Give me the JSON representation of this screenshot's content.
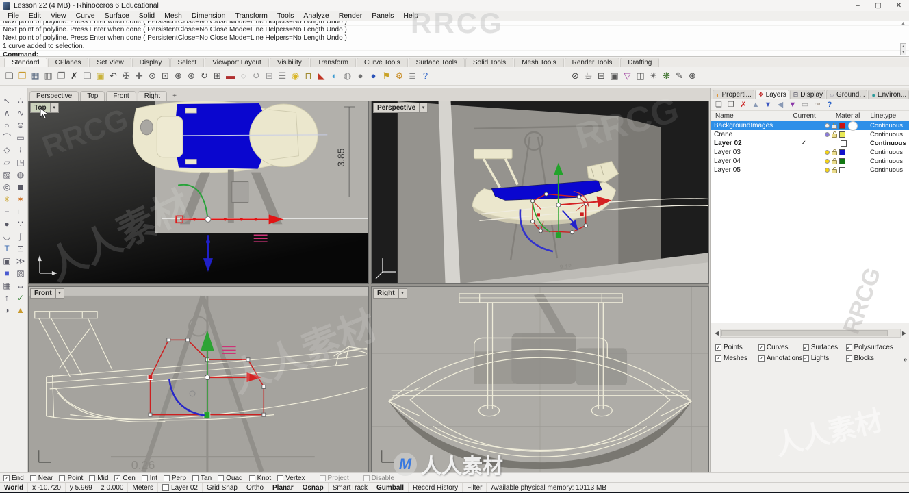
{
  "window": {
    "title": "Lesson 22 (4 MB) - Rhinoceros 6 Educational"
  },
  "menu": [
    "File",
    "Edit",
    "View",
    "Curve",
    "Surface",
    "Solid",
    "Mesh",
    "Dimension",
    "Transform",
    "Tools",
    "Analyze",
    "Render",
    "Panels",
    "Help"
  ],
  "command": {
    "history": [
      "Next point of polyline. Press Enter when done ( PersistentClose=No  Close  Mode=Line  Helpers=No  Length  Undo )",
      "Next point of polyline. Press Enter when done ( PersistentClose=No  Close  Mode=Line  Helpers=No  Length  Undo )",
      "Next point of polyline. Press Enter when done ( PersistentClose=No  Close  Mode=Line  Helpers=No  Length  Undo )",
      "1 curve added to selection."
    ],
    "prompt": "Command:"
  },
  "toolbar_tabs": [
    "Standard",
    "CPlanes",
    "Set View",
    "Display",
    "Select",
    "Viewport Layout",
    "Visibility",
    "Transform",
    "Curve Tools",
    "Surface Tools",
    "Solid Tools",
    "Mesh Tools",
    "Render Tools",
    "Drafting"
  ],
  "icons": {
    "window_controls": [
      {
        "n": "minimize",
        "g": "–"
      },
      {
        "n": "maximize",
        "g": "▢"
      },
      {
        "n": "close",
        "g": "✕"
      }
    ],
    "dropdown": "▾",
    "check": "✓",
    "scroll_up": "▲",
    "scroll_down": "▼",
    "standard": [
      {
        "n": "new-file",
        "g": "❏",
        "c": "#555555"
      },
      {
        "n": "open-file",
        "g": "❒",
        "c": "#c99a2e"
      },
      {
        "n": "save",
        "g": "▦",
        "c": "#5f6f85"
      },
      {
        "n": "print",
        "g": "▥",
        "c": "#6a6a6a"
      },
      {
        "n": "copy-to-clipboard",
        "g": "❐",
        "c": "#6a6a6a"
      },
      {
        "n": "delete",
        "g": "✗",
        "c": "#3a3a3a"
      },
      {
        "n": "copy",
        "g": "❑",
        "c": "#6a6a6a"
      },
      {
        "n": "paste",
        "g": "▣",
        "c": "#c9b23a"
      },
      {
        "n": "undo",
        "g": "↶",
        "c": "#4a4a4a"
      },
      {
        "n": "pan",
        "g": "✠",
        "c": "#6a6a6a"
      },
      {
        "n": "move",
        "g": "✚",
        "c": "#6a6a6a"
      },
      {
        "n": "zoom",
        "g": "⊙",
        "c": "#5a5a5a"
      },
      {
        "n": "zoom-window",
        "g": "⊡",
        "c": "#5a5a5a"
      },
      {
        "n": "zoom-dynamic",
        "g": "⊕",
        "c": "#5a5a5a"
      },
      {
        "n": "zoom-extents",
        "g": "⊛",
        "c": "#5a5a5a"
      },
      {
        "n": "rotate-view",
        "g": "↻",
        "c": "#5a5a5a"
      },
      {
        "n": "viewport-layout",
        "g": "⊞",
        "c": "#5a5a5a"
      },
      {
        "n": "pan-mouse",
        "g": "▬",
        "c": "#b03030"
      },
      {
        "n": "hide-object",
        "g": "◌",
        "c": "#9a9a9a"
      },
      {
        "n": "view-history",
        "g": "↺",
        "c": "#9a9a9a"
      },
      {
        "n": "cplane",
        "g": "⊟",
        "c": "#9a9a9a"
      },
      {
        "n": "object-snap-list",
        "g": "☰",
        "c": "#8a8a8a"
      },
      {
        "n": "light-bulb",
        "g": "◉",
        "c": "#d9b525"
      },
      {
        "n": "lock",
        "g": "⊓",
        "c": "#a08a30"
      },
      {
        "n": "layer-wedge",
        "g": "◣",
        "c": "#c03525"
      },
      {
        "n": "color-wheel",
        "g": "◐",
        "c": "#3a9ad0"
      },
      {
        "n": "shaded-sphere",
        "g": "◍",
        "c": "#8f8f8f"
      },
      {
        "n": "ghosted-sphere",
        "g": "●",
        "c": "#6f6f6f"
      },
      {
        "n": "rendered-sphere",
        "g": "●",
        "c": "#2a52b8"
      },
      {
        "n": "annotate-flag",
        "g": "⚑",
        "c": "#c9a227"
      },
      {
        "n": "settings-gear",
        "g": "⚙",
        "c": "#c98f2b"
      },
      {
        "n": "stack",
        "g": "≣",
        "c": "#888888"
      },
      {
        "n": "help",
        "g": "?",
        "c": "#2a62c8"
      }
    ],
    "standard_right": [
      {
        "n": "no-draw",
        "g": "⊘",
        "c": "#444444"
      },
      {
        "n": "render-teapot",
        "g": "☕",
        "c": "#555555"
      },
      {
        "n": "render-window",
        "g": "⊟",
        "c": "#555555"
      },
      {
        "n": "render-settings",
        "g": "▣",
        "c": "#555555"
      },
      {
        "n": "selection-filter",
        "g": "▽",
        "c": "#a040a0"
      },
      {
        "n": "display-box",
        "g": "◫",
        "c": "#555555"
      },
      {
        "n": "render-lamp",
        "g": "✴",
        "c": "#666666"
      },
      {
        "n": "render-grass",
        "g": "❋",
        "c": "#4a7a3a"
      },
      {
        "n": "annotate-pen",
        "g": "✎",
        "c": "#555555"
      },
      {
        "n": "target-point",
        "g": "⊕",
        "c": "#555555"
      }
    ],
    "palette": [
      {
        "n": "select-arrow",
        "g": "↖"
      },
      {
        "n": "control-points",
        "g": "∴"
      },
      {
        "n": "polyline",
        "g": "∧"
      },
      {
        "n": "curve-points",
        "g": "∿"
      },
      {
        "n": "circle",
        "g": "○"
      },
      {
        "n": "ellipse",
        "g": "⊜"
      },
      {
        "n": "arc",
        "g": "⌒"
      },
      {
        "n": "rectangle",
        "g": "▭"
      },
      {
        "n": "polygon",
        "g": "◇"
      },
      {
        "n": "freeform-curve",
        "g": "≀"
      },
      {
        "n": "surface-plane",
        "g": "▱"
      },
      {
        "n": "surface-corner",
        "g": "◳"
      },
      {
        "n": "box",
        "g": "▧"
      },
      {
        "n": "sphere",
        "g": "◍"
      },
      {
        "n": "torus",
        "g": "◎"
      },
      {
        "n": "solid-union",
        "g": "◼"
      },
      {
        "n": "boolean-union",
        "g": "✳",
        "c": "#c9a227"
      },
      {
        "n": "explode",
        "g": "✶",
        "c": "#d07020"
      },
      {
        "n": "fillet",
        "g": "⌐"
      },
      {
        "n": "chamfer",
        "g": "∟"
      },
      {
        "n": "blob",
        "g": "●"
      },
      {
        "n": "dot-cluster",
        "g": "∵"
      },
      {
        "n": "adjust-arc",
        "g": "◡"
      },
      {
        "n": "curve-handle",
        "g": "∫"
      },
      {
        "n": "text-tool",
        "g": "T",
        "c": "#3a6ab0"
      },
      {
        "n": "point-edit",
        "g": "⊡"
      },
      {
        "n": "block",
        "g": "▣"
      },
      {
        "n": "array",
        "g": "≫"
      },
      {
        "n": "solid-blue",
        "g": "■",
        "c": "#4a5ad0"
      },
      {
        "n": "hatch",
        "g": "▨"
      },
      {
        "n": "grid",
        "g": "▦"
      },
      {
        "n": "dimension",
        "g": "↔"
      },
      {
        "n": "extrude",
        "g": "↑"
      },
      {
        "n": "check",
        "g": "✓",
        "c": "#2a7a2a"
      },
      {
        "n": "shade",
        "g": "◑"
      },
      {
        "n": "gold-part",
        "g": "▲",
        "c": "#c99a2e"
      }
    ],
    "panel_toolbar": [
      {
        "n": "new-layer",
        "g": "❏",
        "c": "#555555"
      },
      {
        "n": "duplicate-layer",
        "g": "❐",
        "c": "#555555"
      },
      {
        "n": "delete-layer",
        "g": "✗",
        "c": "#cc2525"
      },
      {
        "n": "move-layer-up",
        "g": "▲",
        "c": "#8a9ab5"
      },
      {
        "n": "move-layer-down",
        "g": "▼",
        "c": "#3a55c0"
      },
      {
        "n": "collapse-all",
        "g": "◀",
        "c": "#8a9ab5"
      },
      {
        "n": "layer-filter",
        "g": "▼",
        "c": "#8a35a8"
      },
      {
        "n": "match-layer",
        "g": "▭",
        "c": "#999999"
      },
      {
        "n": "layer-tools",
        "g": "✑",
        "c": "#776655"
      },
      {
        "n": "help",
        "g": "?",
        "c": "#2a62c8"
      }
    ]
  },
  "viewport_tabs": [
    "Perspective",
    "Top",
    "Front",
    "Right"
  ],
  "viewports": {
    "top": {
      "label": "Top",
      "dimension": "3.85"
    },
    "perspective": {
      "label": "Perspective",
      "bg_dimension": "9.12"
    },
    "front": {
      "label": "Front",
      "bg_dimension": "0.26"
    },
    "right": {
      "label": "Right"
    }
  },
  "panel": {
    "tabs": [
      {
        "label": "Properti...",
        "icon": "properties",
        "g": "◐",
        "c": "#e08a20",
        "active": false
      },
      {
        "label": "Layers",
        "icon": "layers",
        "g": "❖",
        "c": "#c03030",
        "active": true
      },
      {
        "label": "Display",
        "icon": "display",
        "g": "⊟",
        "c": "#555566",
        "active": false
      },
      {
        "label": "Ground...",
        "icon": "ground-plane",
        "g": "▱",
        "c": "#888899",
        "active": false
      },
      {
        "label": "Environ...",
        "icon": "environment",
        "g": "●",
        "c": "#2a9a9a",
        "active": false
      }
    ],
    "columns": [
      "Name",
      "Current",
      "Material",
      "Linetype"
    ],
    "layers": [
      {
        "name": "BackgroundImages",
        "selected": true,
        "current": false,
        "bulb": "#f2f2f2",
        "locked": true,
        "color": "#cc1111",
        "linetype": "Continuous",
        "material_sphere": true
      },
      {
        "name": "Crane",
        "selected": false,
        "current": false,
        "bulb": "#8a7ad8",
        "locked": false,
        "color": "#e8e855",
        "linetype": "Continuous"
      },
      {
        "name": "Layer 02",
        "selected": false,
        "current": true,
        "no_icons": true,
        "color": "#ffffff",
        "linetype": "Continuous"
      },
      {
        "name": "Layer 03",
        "selected": false,
        "current": false,
        "bulb": "#f5d312",
        "locked": false,
        "color": "#1111cc",
        "linetype": "Continuous"
      },
      {
        "name": "Layer 04",
        "selected": false,
        "current": false,
        "bulb": "#f5d312",
        "locked": false,
        "color": "#117711",
        "linetype": "Continuous"
      },
      {
        "name": "Layer 05",
        "selected": false,
        "current": false,
        "bulb": "#f5d312",
        "locked": false,
        "color": "#ffffff",
        "linetype": "Continuous"
      }
    ],
    "filters": [
      [
        "Points",
        "Curves",
        "Surfaces",
        "Polysurfaces"
      ],
      [
        "Meshes",
        "Annotations",
        "Lights",
        "Blocks"
      ]
    ],
    "more_glyph": "»"
  },
  "osnap": {
    "items": [
      {
        "label": "End",
        "checked": true
      },
      {
        "label": "Near",
        "checked": false
      },
      {
        "label": "Point",
        "checked": false
      },
      {
        "label": "Mid",
        "checked": false
      },
      {
        "label": "Cen",
        "checked": true
      },
      {
        "label": "Int",
        "checked": false
      },
      {
        "label": "Perp",
        "checked": false
      },
      {
        "label": "Tan",
        "checked": false
      },
      {
        "label": "Quad",
        "checked": false
      },
      {
        "label": "Knot",
        "checked": false
      },
      {
        "label": "Vertex",
        "checked": false
      },
      {
        "label": "Project",
        "checked": false,
        "dim": true
      },
      {
        "label": "Disable",
        "checked": false,
        "dim": true
      }
    ]
  },
  "status": {
    "cs": "World",
    "x": "x -10.720",
    "y": "y 5.969",
    "z": "z 0.000",
    "units": "Meters",
    "layer": "Layer 02",
    "toggles": [
      {
        "label": "Grid Snap",
        "active": false
      },
      {
        "label": "Ortho",
        "active": false
      },
      {
        "label": "Planar",
        "active": true
      },
      {
        "label": "Osnap",
        "active": true
      },
      {
        "label": "SmartTrack",
        "active": false
      },
      {
        "label": "Gumball",
        "active": true
      },
      {
        "label": "Record History",
        "active": false
      },
      {
        "label": "Filter",
        "active": false
      }
    ],
    "memory": "Available physical memory: 10113 MB"
  },
  "colors": {
    "selection_blue": "#2e8fe8",
    "gumball_red": "#e01414",
    "gumball_green": "#22a32a",
    "gumball_blue": "#2020c8",
    "deck_blue": "#0a06cf",
    "hull_cream": "#ebe7cd"
  },
  "watermarks": {
    "brand": "RRCG",
    "site": "人人素材"
  }
}
